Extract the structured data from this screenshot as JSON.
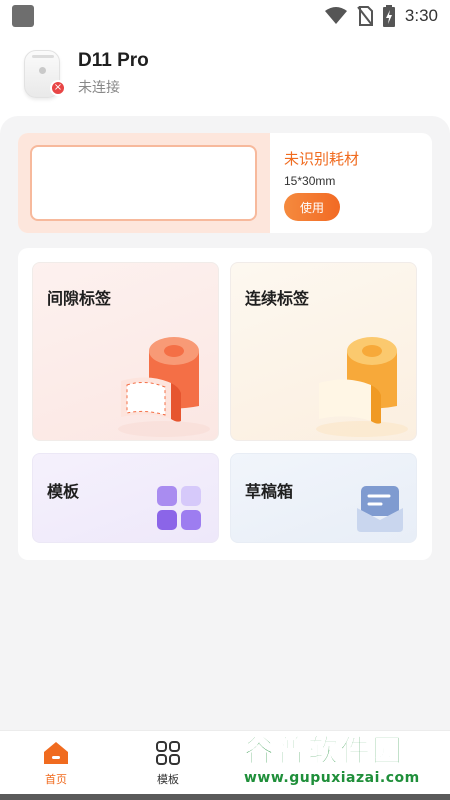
{
  "status_bar": {
    "time": "3:30"
  },
  "device": {
    "name": "D11 Pro",
    "status": "未连接"
  },
  "consumable": {
    "title": "未识别耗材",
    "size": "15*30mm",
    "use_label": "使用"
  },
  "features": {
    "gap_label": "间隙标签",
    "continuous_label": "连续标签",
    "template_label": "模板",
    "draft_label": "草稿箱"
  },
  "bottom_nav": {
    "home_label": "首页",
    "template_label": "模板"
  },
  "watermark": {
    "title": "谷普软件园",
    "url": "www.gupuxiazai.com"
  },
  "colors": {
    "accent": "#f06b1f",
    "watermark": "#1f8f3a"
  }
}
